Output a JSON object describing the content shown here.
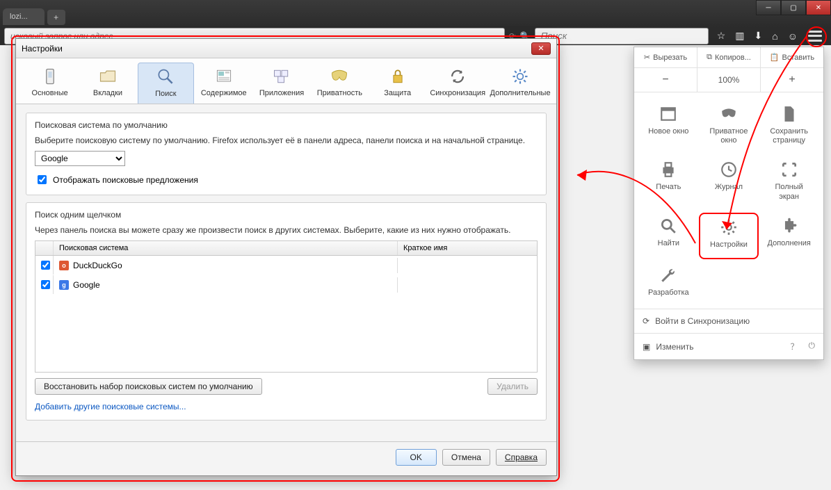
{
  "window": {
    "tab_title": "lozi..."
  },
  "navbar": {
    "address_placeholder": "исковый запрос или адрес",
    "search_placeholder": "Поиск"
  },
  "menu": {
    "top": {
      "cut": "Вырезать",
      "copy": "Копиров...",
      "paste": "Вставить"
    },
    "zoom": {
      "minus": "−",
      "value": "100%",
      "plus": "+"
    },
    "items": [
      {
        "label": "Новое окно"
      },
      {
        "label": "Приватное\nокно"
      },
      {
        "label": "Сохранить\nстраницу"
      },
      {
        "label": "Печать"
      },
      {
        "label": "Журнал"
      },
      {
        "label": "Полный\nэкран"
      },
      {
        "label": "Найти"
      },
      {
        "label": "Настройки"
      },
      {
        "label": "Дополнения"
      },
      {
        "label": "Разработка"
      }
    ],
    "sync": "Войти в Синхронизацию",
    "customize": "Изменить"
  },
  "dialog": {
    "title": "Настройки",
    "tabs": {
      "general": "Основные",
      "tabs": "Вкладки",
      "search": "Поиск",
      "content": "Содержимое",
      "apps": "Приложения",
      "privacy": "Приватность",
      "security": "Защита",
      "sync": "Синхронизация",
      "advanced": "Дополнительные"
    },
    "default_engine": {
      "title": "Поисковая система по умолчанию",
      "hint": "Выберите поисковую систему по умолчанию. Firefox использует её в панели адреса, панели поиска и на начальной странице.",
      "selected": "Google",
      "suggestions_label": "Отображать поисковые предложения"
    },
    "oneclick": {
      "title": "Поиск одним щелчком",
      "hint": "Через панель поиска вы можете сразу же произвести поиск в других системах. Выберите, какие из них нужно отображать.",
      "col_engine": "Поисковая система",
      "col_short": "Краткое имя",
      "engines": [
        {
          "name": "DuckDuckGo",
          "icon": "ddg"
        },
        {
          "name": "Google",
          "icon": "goog"
        }
      ],
      "restore": "Восстановить набор поисковых систем по умолчанию",
      "remove": "Удалить",
      "add_link": "Добавить другие поисковые системы..."
    },
    "buttons": {
      "ok": "OK",
      "cancel": "Отмена",
      "help": "Справка"
    }
  }
}
